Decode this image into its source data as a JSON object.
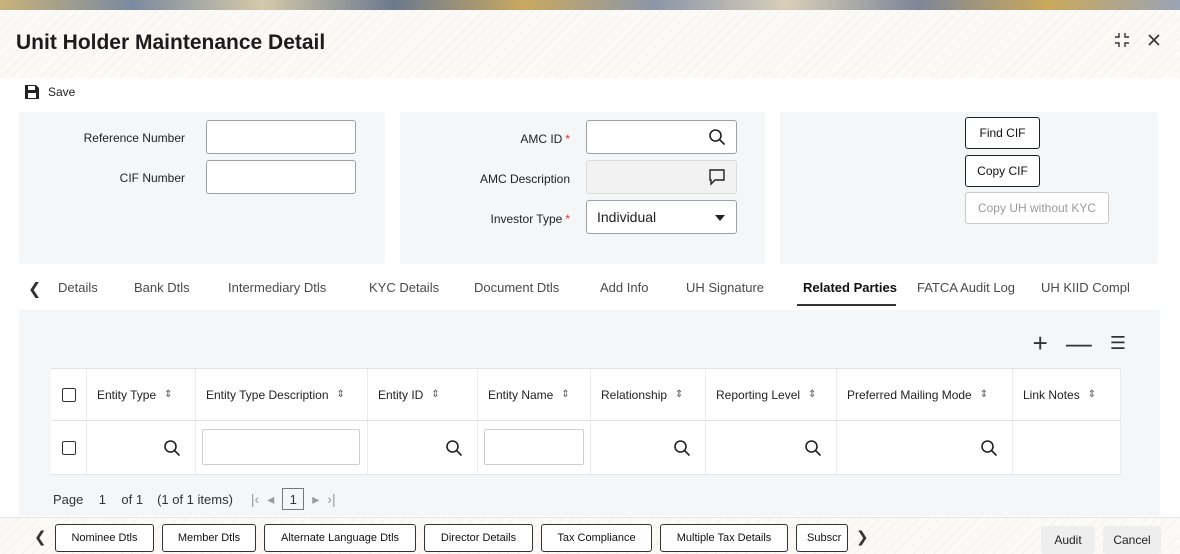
{
  "window": {
    "title": "Unit Holder Maintenance Detail",
    "minimize_icon": "collapse-icon",
    "close_icon": "close-icon"
  },
  "toolbar": {
    "save_label": "Save"
  },
  "form": {
    "reference_number_label": "Reference Number",
    "reference_number_value": "",
    "cif_number_label": "CIF Number",
    "cif_number_value": "",
    "amc_id_label": "AMC ID",
    "amc_id_value": "",
    "amc_description_label": "AMC Description",
    "amc_description_value": "",
    "investor_type_label": "Investor Type",
    "investor_type_value": "Individual",
    "required_marker": "*"
  },
  "actions": {
    "find_cif": "Find CIF",
    "copy_cif": "Copy CIF",
    "copy_uh_without_kyc": "Copy UH without KYC"
  },
  "tabs": [
    {
      "label": "Details"
    },
    {
      "label": "Bank Dtls"
    },
    {
      "label": "Intermediary Dtls"
    },
    {
      "label": "KYC Details"
    },
    {
      "label": "Document Dtls"
    },
    {
      "label": "Add Info"
    },
    {
      "label": "UH Signature"
    },
    {
      "label": "Related Parties",
      "active": true
    },
    {
      "label": "FATCA Audit Log"
    },
    {
      "label": "UH KIID Compl"
    }
  ],
  "grid": {
    "columns": [
      "Entity Type",
      "Entity Type Description",
      "Entity ID",
      "Entity Name",
      "Relationship",
      "Reporting Level",
      "Preferred Mailing Mode",
      "Link Notes"
    ],
    "pager": {
      "page_label": "Page",
      "current_page": "1",
      "of_label": "of 1",
      "items_label": "(1 of 1 items)",
      "page_button": "1"
    }
  },
  "footer": {
    "buttons": [
      "Nominee Dtls",
      "Member Dtls",
      "Alternate Language Dtls",
      "Director Details",
      "Tax Compliance",
      "Multiple Tax Details",
      "Subscr"
    ],
    "audit_label": "Audit",
    "cancel_label": "Cancel"
  }
}
